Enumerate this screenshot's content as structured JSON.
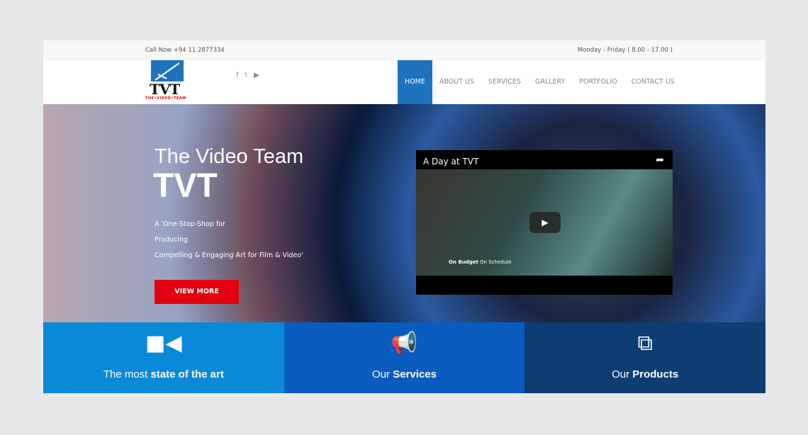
{
  "topbar": {
    "phone": "Call Now +94 11 2877334",
    "hours": "Monday - Friday ( 8.00 - 17.00 )"
  },
  "logo": {
    "text": "TVT",
    "subtitle": "THE•VIDEO•TEAM"
  },
  "social": [
    {
      "icon": "facebook-icon",
      "glyph": "f"
    },
    {
      "icon": "twitter-icon",
      "glyph": "🐦"
    },
    {
      "icon": "youtube-icon",
      "glyph": "▶"
    }
  ],
  "nav": [
    {
      "label": "HOME",
      "active": true
    },
    {
      "label": "ABOUT US"
    },
    {
      "label": "SERVICES"
    },
    {
      "label": "GALLERY"
    },
    {
      "label": "PORTFOLIO"
    },
    {
      "label": "CONTACT US"
    }
  ],
  "hero": {
    "title": "The Video Team",
    "subtitle": "TVT",
    "tagline": [
      "A 'One-Stop-Shop for",
      "Producing",
      "Compelling & Engaging Art for Film & Video'"
    ],
    "button": "VIEW MORE"
  },
  "video": {
    "title": "A Day at TVT",
    "caption_bold": "On Budget",
    "caption": " On Schedule"
  },
  "features": [
    {
      "pre": "The most ",
      "bold": "state of the art",
      "color": "#0a8ad6"
    },
    {
      "pre": "Our ",
      "bold": "Services",
      "color": "#0a5cbf"
    },
    {
      "pre": "Our ",
      "bold": "Products",
      "color": "#0d3d73"
    }
  ]
}
